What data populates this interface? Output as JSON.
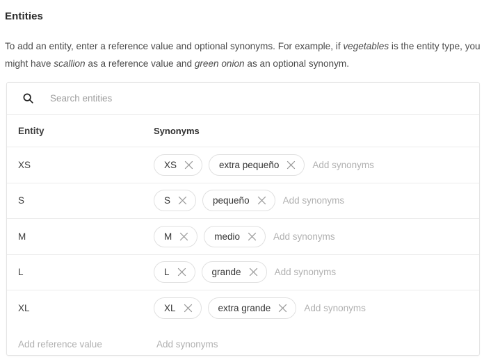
{
  "heading": "Entities",
  "intro": {
    "part1": "To add an entity, enter a reference value and optional synonyms. For example, if ",
    "em1": "vegetables",
    "part2": " is the entity type, you might have ",
    "em2": "scallion",
    "part3": " as a reference value and ",
    "em3": "green onion",
    "part4": " as an optional synonym."
  },
  "search": {
    "icon": "search-icon",
    "value": "",
    "placeholder": "Search entities"
  },
  "table": {
    "columns": [
      "Entity",
      "Synonyms"
    ],
    "add_synonyms_placeholder": "Add synonyms",
    "remove_icon": "close-icon",
    "rows": [
      {
        "entity": "XS",
        "synonyms": [
          "XS",
          "extra pequeño"
        ]
      },
      {
        "entity": "S",
        "synonyms": [
          "S",
          "pequeño"
        ]
      },
      {
        "entity": "M",
        "synonyms": [
          "M",
          "medio"
        ]
      },
      {
        "entity": "L",
        "synonyms": [
          "L",
          "grande"
        ]
      },
      {
        "entity": "XL",
        "synonyms": [
          "XL",
          "extra grande"
        ]
      }
    ],
    "new_row": {
      "entity_placeholder": "Add reference value",
      "synonyms_placeholder": "Add synonyms"
    }
  },
  "colors": {
    "text": "#323232",
    "muted": "#b0b0b0",
    "border": "#e4e4e4",
    "divider": "#ececec",
    "chip_border": "#e0e0e0"
  }
}
